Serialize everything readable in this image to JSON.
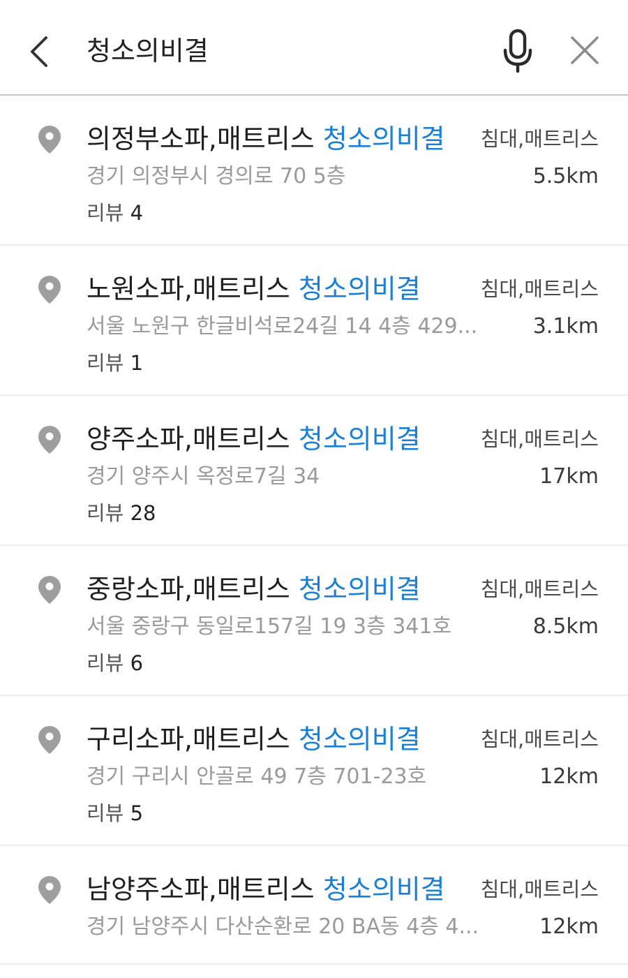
{
  "search": {
    "query": "청소의비결"
  },
  "icons": {
    "back": "chevron-left-icon",
    "mic": "microphone-icon",
    "close": "close-icon",
    "pin": "map-pin-icon"
  },
  "colors": {
    "highlight": "#1a7fd6",
    "pin": "#9e9e9e",
    "address": "#9a9a9a"
  },
  "review_label": "리뷰",
  "results": [
    {
      "name_prefix": "의정부소파,매트리스",
      "name_highlight": "청소의비결",
      "category": "침대,매트리스",
      "address": "경기 의정부시 경의로 70 5층",
      "distance": "5.5km",
      "review_count": "4"
    },
    {
      "name_prefix": "노원소파,매트리스",
      "name_highlight": "청소의비결",
      "category": "침대,매트리스",
      "address": "서울 노원구 한글비석로24길 14 4층 429...",
      "distance": "3.1km",
      "review_count": "1"
    },
    {
      "name_prefix": "양주소파,매트리스",
      "name_highlight": "청소의비결",
      "category": "침대,매트리스",
      "address": "경기 양주시 옥정로7길 34",
      "distance": "17km",
      "review_count": "28"
    },
    {
      "name_prefix": "중랑소파,매트리스",
      "name_highlight": "청소의비결",
      "category": "침대,매트리스",
      "address": "서울 중랑구 동일로157길 19 3층 341호",
      "distance": "8.5km",
      "review_count": "6"
    },
    {
      "name_prefix": "구리소파,매트리스",
      "name_highlight": "청소의비결",
      "category": "침대,매트리스",
      "address": "경기 구리시 안골로 49 7층 701-23호",
      "distance": "12km",
      "review_count": "5"
    },
    {
      "name_prefix": "남양주소파,매트리스",
      "name_highlight": "청소의비결",
      "category": "침대,매트리스",
      "address": "경기 남양주시 다산순환로 20 BA동 4층 4...",
      "distance": "12km",
      "review_count": null
    }
  ]
}
